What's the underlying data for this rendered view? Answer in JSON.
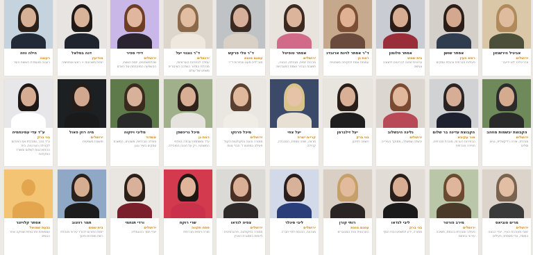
{
  "placeholder_photo_color": "#f2c474",
  "accent_color": "#d2891f",
  "cards": [
    {
      "name": "הילה ווזה",
      "place": "רעננה",
      "desc": "רעננה מועמדת ראשות העיר",
      "photo": {
        "bg": "#c5d3df",
        "hair": "#2b2018",
        "body": "#222a38",
        "skin": "#d7b196"
      }
    },
    {
      "name": "דנה בסלאל",
      "place": "מודיעין",
      "desc": "יזמית משכונות + ראש אופוזיציה",
      "photo": {
        "bg": "#e7e4e1",
        "hair": "#1f1a17",
        "body": "#20242e",
        "skin": "#d8b39a"
      }
    },
    {
      "name": "דידי ספיר",
      "place": "ירושלים",
      "desc": "שהלמשפטים, יזמת הצוות, ההשפעה המוקדמת של האדם",
      "photo": {
        "bg": "#c9b7e8",
        "hair": "#6d3e24",
        "body": "#2a2430",
        "skin": "#e0b79e"
      }
    },
    {
      "name": "ד\"ר נוגנוי יעל",
      "place": "ירושלים",
      "desc": "עמלה לבחירות העירוניות, מנהלת המדור השלכה הציבורית משפט של עולם",
      "photo": {
        "bg": "#ddd6cd",
        "hair": "#8a6a4a",
        "body": "#efe8de",
        "skin": "#e2bda2"
      }
    },
    {
      "name": "ד\"ר טלי פרקש",
      "place": "עמנם מוצא",
      "desc": "מנכ\"לית מעט ובחירות ד\"ר",
      "photo": {
        "bg": "#bfc3c6",
        "hair": "#3a2b22",
        "body": "#d9d1c6",
        "skin": "#d6b09a"
      }
    },
    {
      "name": "אסתר טופיטל",
      "place": "ירושלים",
      "desc": "מרכזת יזמית, מנהלת, הבונה, תושבת הבהיר ושמת התנגדויות",
      "photo": {
        "bg": "#e9e3dd",
        "hair": "#3c2a20",
        "body": "#d26b8a",
        "skin": "#dcb49b"
      }
    },
    {
      "name": "ד\"ר אסתר לוינת ארובדניקוביץ",
      "place": "רמת גן",
      "desc": "עמותת אמת לתקיפה משפטית",
      "photo": {
        "bg": "#c6a98d",
        "hair": "#7a4f34",
        "body": "#6a4a3c",
        "skin": "#e0b293"
      }
    },
    {
      "name": "אסתר סלומון",
      "place": "בית שמש",
      "desc": "עירונית זמינה לבריונים לתגובה ונגישה",
      "photo": {
        "bg": "#c9cdd3",
        "hair": "#2a1d17",
        "body": "#9a2d3a",
        "skin": "#d7ad93"
      }
    },
    {
      "name": "אסתר שושן",
      "place": "ראש העין",
      "desc": "פעילות חברתית ובעלת עסקים",
      "photo": {
        "bg": "#d4d0c9",
        "hair": "#2b1e18",
        "body": "#2f3d4f",
        "skin": "#d4a88e"
      }
    },
    {
      "name": "אביגיל הירשנזון",
      "place": "ירושלים",
      "desc": "אדריכלית 'לא ידיעה'",
      "photo": {
        "bg": "#d9c7a8",
        "hair": "#b08a5a",
        "body": "#4c4f3a",
        "skin": "#e0bc9e"
      }
    },
    {
      "name": "ע\"ד עדי עמינחמיה",
      "place": "בני ברק",
      "desc": "ע\"ד חבר, ומנהלת את הפורום לקהילה הצרכנית, בית ההתארגנות לשלום ומשרד הפקידות",
      "photo": {
        "bg": "#e7e7e9",
        "hair": "#1e1816",
        "body": "#ffffff",
        "skin": "#d6ad93"
      }
    },
    {
      "name": "מיה רוזן פאול",
      "place": "ירושלים",
      "desc": "תושבת משפטית",
      "photo": {
        "bg": "#1d2023",
        "hair": "#241c18",
        "body": "#1a1a1a",
        "skin": "#d1a78f"
      }
    },
    {
      "name": "מליבי ויזקוה",
      "place": "אשדוד",
      "desc": "פעילה חברתית, משכנים, המשכת עסקים בשיר ובגן",
      "photo": {
        "bg": "#5e7a4a",
        "hair": "#3a2a1e",
        "body": "#2a2a2a",
        "skin": "#d8b19a"
      }
    },
    {
      "name": "מיכל גרינשפן",
      "place": "רמת גן",
      "desc": "ע\"ד ומשתמת עבודה באלפי המשפטי, רק על הכנה המובילה",
      "photo": {
        "bg": "#9fb08a",
        "hair": "#2e221b",
        "body": "#e6e3df",
        "skin": "#d8ae94"
      }
    },
    {
      "name": "מיכל פרנקו",
      "place": "ירושלים",
      "desc": "ממורה והוגה בפקולטות הקול פעילה במפגש ד' חברי צוות",
      "photo": {
        "bg": "#eae6e1",
        "hair": "#5a4030",
        "body": "#f0ece6",
        "skin": "#e0b89c"
      }
    },
    {
      "name": "יעל צחי",
      "place": "קריית ישרה",
      "desc": "מרצה, שפה נוספת, המכבלה, קהילה",
      "photo": {
        "bg": "#3c4a6a",
        "hair": "#d8c38a",
        "body": "#e8e0d2",
        "skin": "#e6c3a6"
      }
    },
    {
      "name": "יעל זילברמן",
      "place": "בני ברק",
      "desc": "השפה לפיכון",
      "photo": {
        "bg": "#e8e4de",
        "hair": "#2a1f18",
        "body": "#1e1e1e",
        "skin": "#d9b096"
      }
    },
    {
      "name": "גלינה היבשלוב",
      "place": "ירושלים",
      "desc": "יבשלה שמשלה, ממוקד בעירייה",
      "photo": {
        "bg": "#dcd6d0",
        "hair": "#7a4a32",
        "body": "#b84a58",
        "skin": "#e2b89c"
      }
    },
    {
      "name": "הקבוצת עדינה בר שלום",
      "place": "אור עקיבא",
      "desc": "הבחירות הערות, מוכרת חברתית, חפירה חברתית",
      "photo": {
        "bg": "#d0d2d4",
        "hair": "#2a2424",
        "body": "#1e2230",
        "skin": "#d8ad96"
      }
    },
    {
      "name": "הקבוצת יבשמות מוזהב",
      "place": "ירושלים",
      "desc": "מנהלת, אורה רדיקאלית, נגיש וסלים",
      "photo": {
        "bg": "#6f8a5a",
        "hair": "#2b2b2b",
        "body": "#2a2a2a",
        "skin": "#d5ab90"
      }
    },
    {
      "name": "אסתר קלויזנר",
      "place": "גבעת שמואל",
      "desc": "עצמאיות ותרבותית שוויקה אחר הנשים",
      "photo": {
        "bg": "#f2c474",
        "placeholder": true
      }
    },
    {
      "name": "תמר רוזנוב",
      "place": "בית שמש",
      "desc": "יזמת הפורום לכורד עירוני מנהלת רשת מוסדות חינוך",
      "photo": {
        "bg": "#8fa8c6",
        "hair": "#2a211c",
        "body": "#1c1c1c",
        "skin": "#d7ad92"
      }
    },
    {
      "name": "ורדי תנחמי",
      "place": "ירושלים",
      "desc": "יעדי תמר בהוגמליה",
      "photo": {
        "bg": "#e9e5e0",
        "hair": "#2c2018",
        "body": "#7a1f2c",
        "skin": "#d9b09a"
      }
    },
    {
      "name": "שרי רוקח",
      "place": "פתח תקווה",
      "desc": "מורה ויזמית חברתית",
      "photo": {
        "bg": "#d33a4e",
        "hair": "#1f1714",
        "body": "#c9324a",
        "skin": "#e0b49b"
      }
    },
    {
      "name": "צפיה לנדאו",
      "place": "ירושלים",
      "desc": "ממורה בפקולטה, פרוגרסיבית ליזמות במסגרת הארץ",
      "photo": {
        "bg": "#dcdad6",
        "hair": "#4a3024",
        "body": "#2e2a2a",
        "skin": "#d9af96"
      }
    },
    {
      "name": "ליבי סיגלר",
      "place": "ירושלים",
      "desc": "מנהיגה, הכנסת לחיי חברה",
      "photo": {
        "bg": "#d2d9e8",
        "hair": "#2a1f1c",
        "body": "#2a3e7a",
        "skin": "#d8b19a"
      }
    },
    {
      "name": "רותי קורן",
      "place": "עמנם מוצא",
      "desc": "הארגונית וכוח המבוגרים",
      "photo": {
        "bg": "#d9cfc4",
        "hair": "#c6a06a",
        "body": "#2a2424",
        "skin": "#e1bb9c"
      }
    },
    {
      "name": "ליבי לנדאו",
      "place": "בני ברק",
      "desc": "ממורה, ידע למשפט ובתי הסף",
      "photo": {
        "bg": "#e2dcd6",
        "hair": "#2a1e1a",
        "body": "#1a1a1a",
        "skin": "#d7ad94"
      }
    },
    {
      "name": "מירב פורטר",
      "place": "ירושלים",
      "desc": "פעילה ומנהלת בכנסת, חשיבה עירוני בתחום",
      "photo": {
        "bg": "#b9c6a8",
        "hair": "#6a4a30",
        "body": "#4a3a2a",
        "skin": "#dfb69c"
      }
    },
    {
      "name": "מרים טוביאס",
      "place": "ירושלים",
      "desc": "ישובי מעורבת העיר, יעדי הבונה המוסד, עדי משפחה פעילים",
      "photo": {
        "bg": "#dcd4ca",
        "hair": "#7a6450",
        "body": "#3a3a3a",
        "skin": "#e2bfa4"
      }
    }
  ]
}
